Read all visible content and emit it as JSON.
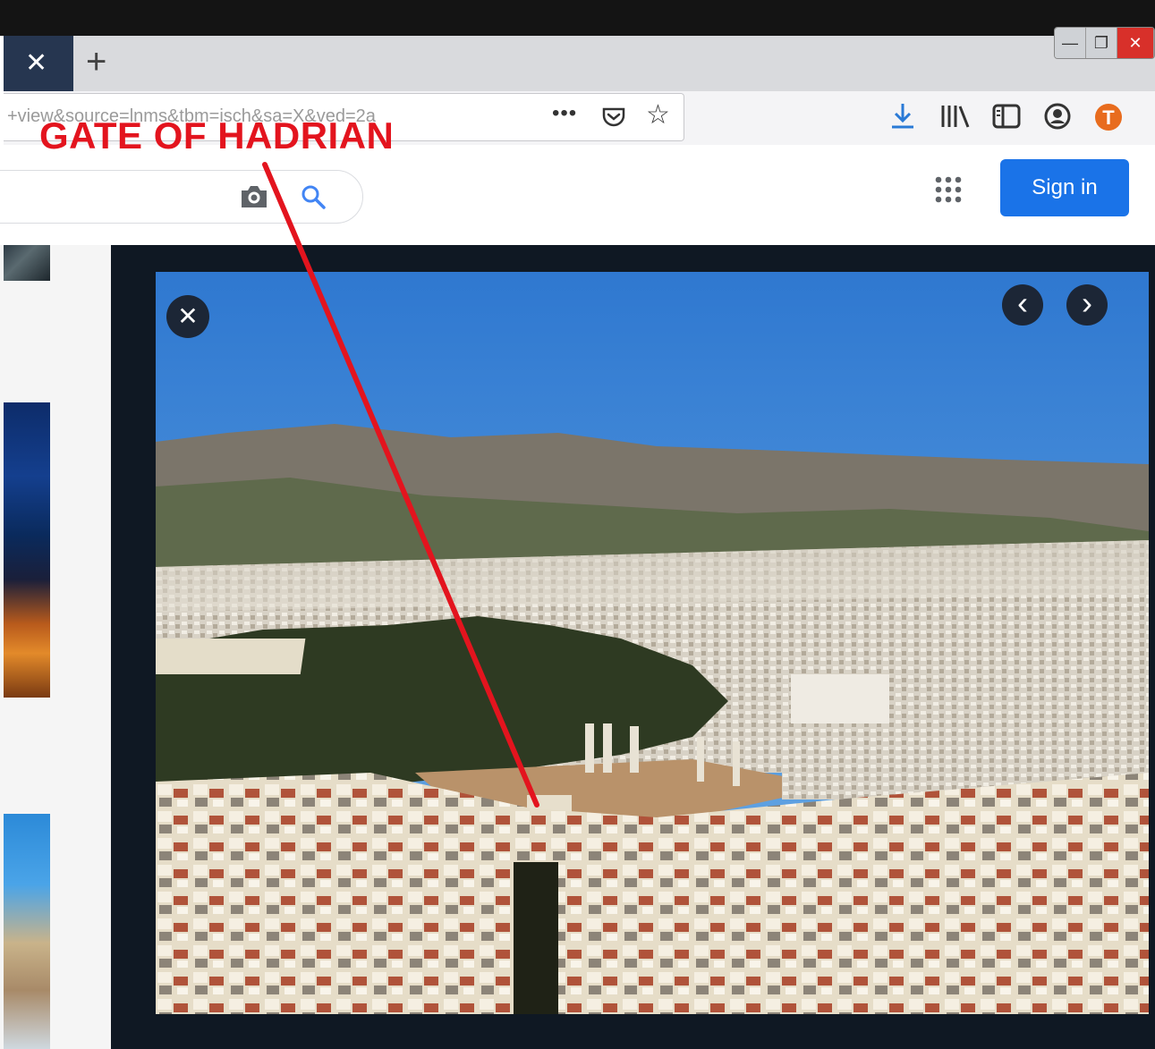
{
  "browser": {
    "tab_close_glyph": "✕",
    "new_tab_glyph": "+",
    "window_controls": [
      "—",
      "❐",
      "✕"
    ],
    "url_text": "+view&source=lnms&tbm=isch&sa=X&ved=2a",
    "url_actions_glyph": "•••",
    "toolbar_icons": [
      "download-icon",
      "library-icon",
      "sidebar-icon",
      "account-icon",
      "profile-icon"
    ],
    "profile_initial": "T",
    "accent_color": "#2a7ad6",
    "profile_color": "#e86c1e"
  },
  "google": {
    "icons": [
      "camera-icon",
      "search-icon",
      "apps-grid-icon"
    ],
    "signin_label": "Sign in",
    "signin_color": "#1a73e8"
  },
  "viewer": {
    "background": "#0f1823",
    "close_glyph": "✕",
    "prev_glyph": "‹",
    "next_glyph": "›"
  },
  "annotation": {
    "label": "GATE OF HADRIAN",
    "color": "#e3141e"
  }
}
